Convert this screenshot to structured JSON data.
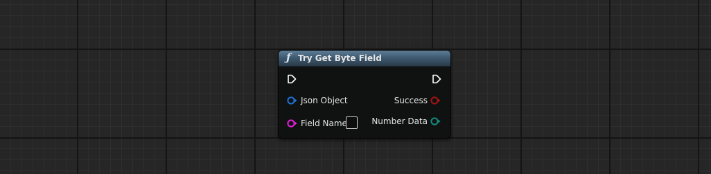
{
  "node": {
    "title": "Try Get Byte Field",
    "icon": "function-icon",
    "header_color": "#3f5b72"
  },
  "inputs": {
    "json_object_label": "Json Object",
    "field_name_label": "Field Name",
    "field_name_value": ""
  },
  "outputs": {
    "success_label": "Success",
    "number_data_label": "Number Data"
  },
  "pin_colors": {
    "exec": "#ffffff",
    "object": "#1f6fd6",
    "string": "#e020d8",
    "bool": "#a21414",
    "number": "#138a7e"
  }
}
